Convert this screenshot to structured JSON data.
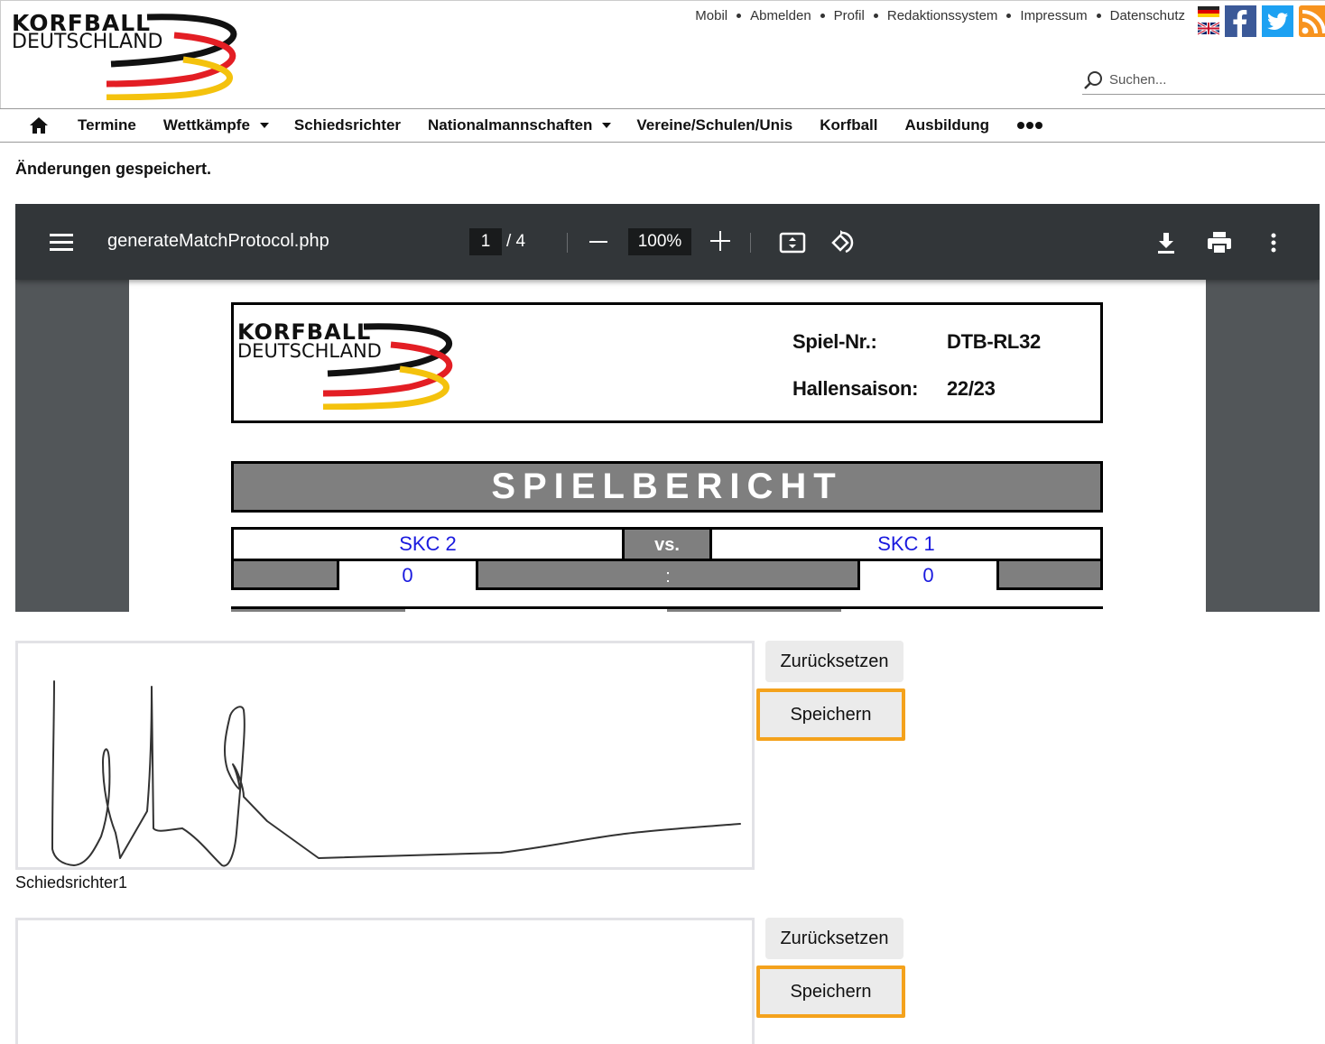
{
  "header": {
    "logo_line1": "KORFBALL",
    "logo_line2": "DEUTSCHLAND",
    "topnav": [
      "Mobil",
      "Abmelden",
      "Profil",
      "Redaktionssystem",
      "Impressum",
      "Datenschutz"
    ],
    "search_placeholder": "Suchen..."
  },
  "mainnav": {
    "items": [
      {
        "label": "Termine",
        "dropdown": false
      },
      {
        "label": "Wettkämpfe",
        "dropdown": true
      },
      {
        "label": "Schiedsrichter",
        "dropdown": false
      },
      {
        "label": "Nationalmannschaften",
        "dropdown": true
      },
      {
        "label": "Vereine/Schulen/Unis",
        "dropdown": false
      },
      {
        "label": "Korfball",
        "dropdown": false
      },
      {
        "label": "Ausbildung",
        "dropdown": false
      }
    ]
  },
  "status_message": "Änderungen gespeichert.",
  "pdf_viewer": {
    "filename": "generateMatchProtocol.php",
    "current_page": "1",
    "page_separator": "/ 4",
    "zoom": "100%",
    "document": {
      "logo_line1": "KORFBALL",
      "logo_line2": "DEUTSCHLAND",
      "game_no_label": "Spiel-Nr.:",
      "game_no_value": "DTB-RL32",
      "season_label": "Hallensaison:",
      "season_value": "22/23",
      "title": "SPIELBERICHT",
      "home_team": "SKC 2",
      "vs_label": "vs.",
      "away_team": "SKC 1",
      "home_score": "0",
      "score_separator": ":",
      "away_score": "0"
    }
  },
  "signatures": [
    {
      "reset_label": "Zurücksetzen",
      "save_label": "Speichern",
      "caption": "Schiedsrichter1"
    },
    {
      "reset_label": "Zurücksetzen",
      "save_label": "Speichern"
    }
  ],
  "colors": {
    "accent_border": "#f4a21c",
    "toolbar": "#323639",
    "viewer_bg": "#525659",
    "team_link": "#1a1adf",
    "title_bar": "#7f7f7f"
  }
}
